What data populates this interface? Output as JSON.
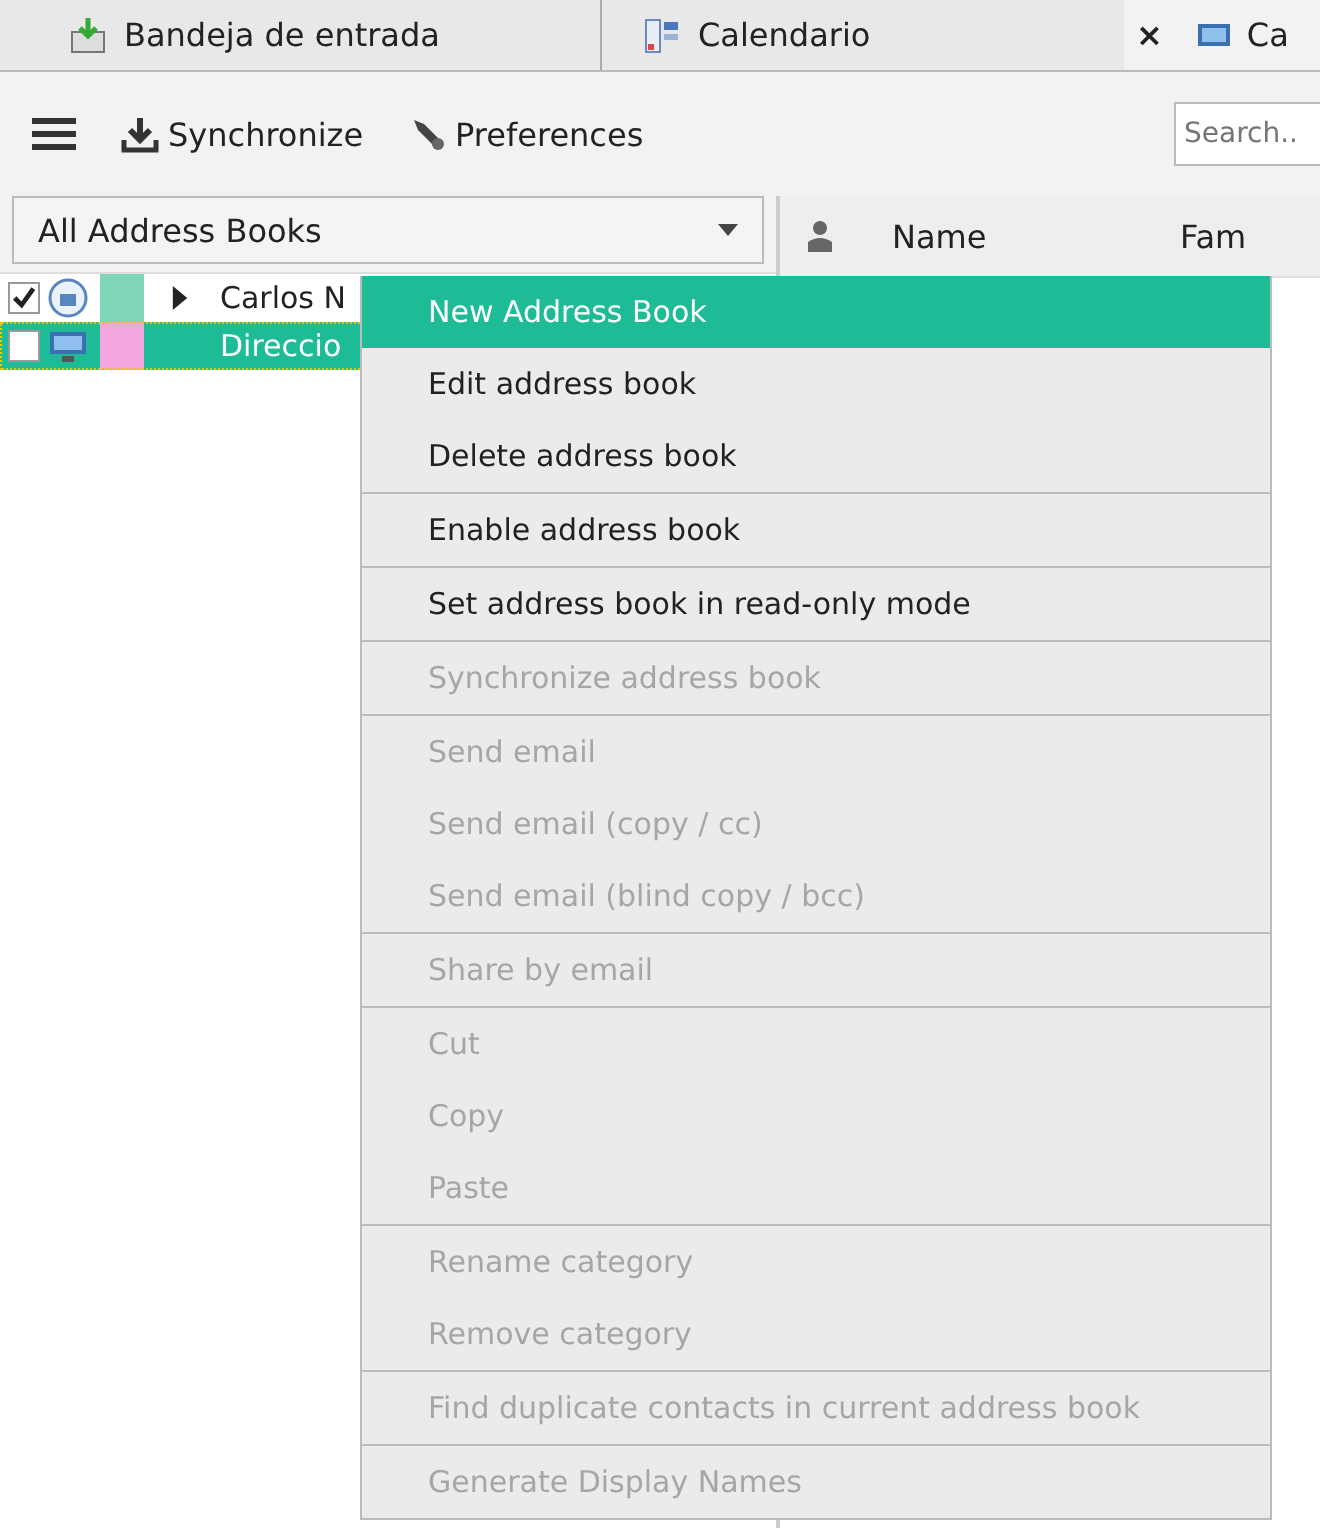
{
  "tabs": [
    {
      "label": "Bandeja de entrada",
      "selected": false,
      "closable": false
    },
    {
      "label": "Calendario",
      "selected": false,
      "closable": false
    },
    {
      "label": "Ca",
      "selected": true,
      "closable": true
    }
  ],
  "close_symbol": "×",
  "toolbar": {
    "items": [
      {
        "kind": "menu"
      },
      {
        "kind": "sync",
        "label": "Synchronize"
      },
      {
        "kind": "prefs",
        "label": "Preferences"
      }
    ],
    "search": {
      "placeholder": "Search.."
    }
  },
  "address_book_selector": {
    "value": "All Address Books"
  },
  "address_books": [
    {
      "name": "Carlos N",
      "checked": true,
      "color": "#7fd6bb",
      "expandable": true,
      "selected": false
    },
    {
      "name": "Direccio",
      "checked": false,
      "color": "#f3a6df",
      "expandable": false,
      "selected": true
    }
  ],
  "columns": [
    {
      "kind": "icon"
    },
    {
      "kind": "text",
      "label": "Name"
    },
    {
      "kind": "text",
      "label": "Fam"
    }
  ],
  "context_menu": [
    {
      "label": "New Address Book",
      "selected": true,
      "disabled": false,
      "separator_before": false
    },
    {
      "label": "Edit address book",
      "selected": false,
      "disabled": false,
      "separator_before": false
    },
    {
      "label": "Delete address book",
      "selected": false,
      "disabled": false,
      "separator_before": false
    },
    {
      "label": "Enable address book",
      "selected": false,
      "disabled": false,
      "separator_before": true
    },
    {
      "label": "Set address book in read-only mode",
      "selected": false,
      "disabled": false,
      "separator_before": true
    },
    {
      "label": "Synchronize address book",
      "selected": false,
      "disabled": true,
      "separator_before": true
    },
    {
      "label": "Send email",
      "selected": false,
      "disabled": true,
      "separator_before": true
    },
    {
      "label": "Send email (copy / cc)",
      "selected": false,
      "disabled": true,
      "separator_before": false
    },
    {
      "label": "Send email (blind copy / bcc)",
      "selected": false,
      "disabled": true,
      "separator_before": false
    },
    {
      "label": "Share by email",
      "selected": false,
      "disabled": true,
      "separator_before": true
    },
    {
      "label": "Cut",
      "selected": false,
      "disabled": true,
      "separator_before": true
    },
    {
      "label": "Copy",
      "selected": false,
      "disabled": true,
      "separator_before": false
    },
    {
      "label": "Paste",
      "selected": false,
      "disabled": true,
      "separator_before": false
    },
    {
      "label": "Rename category",
      "selected": false,
      "disabled": true,
      "separator_before": true
    },
    {
      "label": "Remove category",
      "selected": false,
      "disabled": true,
      "separator_before": false
    },
    {
      "label": "Find duplicate contacts in current address book",
      "selected": false,
      "disabled": true,
      "separator_before": true
    },
    {
      "label": "Generate Display Names",
      "selected": false,
      "disabled": true,
      "separator_before": true
    }
  ]
}
